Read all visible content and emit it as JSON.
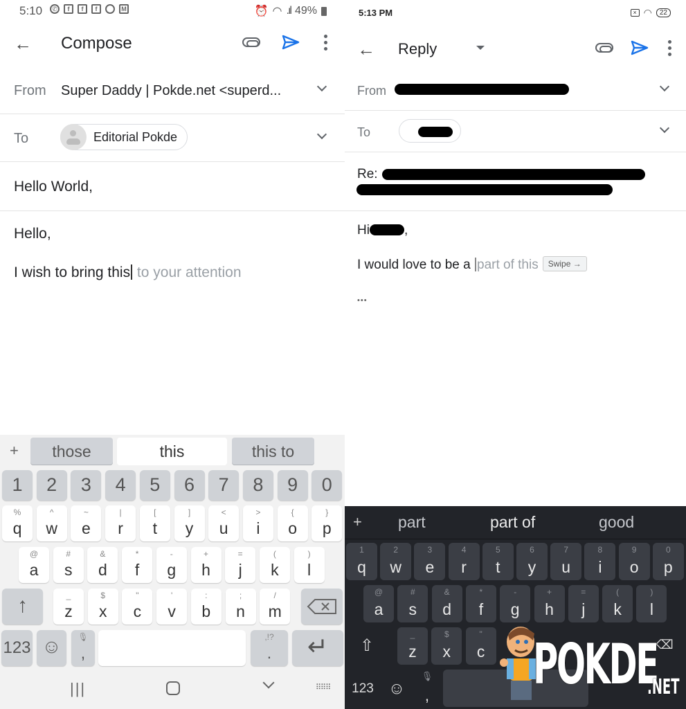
{
  "left": {
    "status": {
      "time": "5:10",
      "notifications": [
        "whatsapp-icon",
        "facebook-icon",
        "facebook-icon",
        "facebook-icon",
        "chrome-icon",
        "gmail-icon"
      ],
      "battery": "49%"
    },
    "appbar": {
      "title": "Compose"
    },
    "from": {
      "label": "From",
      "value": "Super Daddy | Pokde.net <superd..."
    },
    "to": {
      "label": "To",
      "recipient": "Editorial Pokde"
    },
    "subject": "Hello World,",
    "body": {
      "line1": "Hello,",
      "typed": "I wish to bring this",
      "suggestion": " to your attention"
    },
    "keyboard": {
      "suggestions": [
        "those",
        "this",
        "this to"
      ],
      "numbers": [
        "1",
        "2",
        "3",
        "4",
        "5",
        "6",
        "7",
        "8",
        "9",
        "0"
      ],
      "row1": [
        [
          "q",
          "%"
        ],
        [
          "w",
          "^"
        ],
        [
          "e",
          "~"
        ],
        [
          "r",
          "|"
        ],
        [
          "t",
          "["
        ],
        [
          "y",
          "]"
        ],
        [
          "u",
          "<"
        ],
        [
          "i",
          ">"
        ],
        [
          "o",
          "{"
        ],
        [
          "p",
          "}"
        ]
      ],
      "row2": [
        [
          "a",
          "@"
        ],
        [
          "s",
          "#"
        ],
        [
          "d",
          "&"
        ],
        [
          "f",
          "*"
        ],
        [
          "g",
          "-"
        ],
        [
          "h",
          "+"
        ],
        [
          "j",
          "="
        ],
        [
          "k",
          "("
        ],
        [
          "l",
          ")"
        ]
      ],
      "row3": [
        [
          "z",
          "_"
        ],
        [
          "x",
          "$"
        ],
        [
          "c",
          "\""
        ],
        [
          "v",
          "'"
        ],
        [
          "b",
          ":"
        ],
        [
          "n",
          ";"
        ],
        [
          "m",
          "/"
        ]
      ],
      "mode_label": "123",
      "comma": ",",
      "period": ".",
      "period_sub": ",!?"
    }
  },
  "right": {
    "status": {
      "time": "5:13 PM",
      "battery": "22"
    },
    "appbar": {
      "title": "Reply"
    },
    "from": {
      "label": "From"
    },
    "to": {
      "label": "To"
    },
    "subject_prefix": "Re:",
    "body": {
      "greeting": "Hi",
      "greeting_suffix": ",",
      "typed": "I would love to be a ",
      "suggestion": "part of this",
      "swipe_chip": "Swipe →",
      "ellipsis": "•••"
    },
    "keyboard": {
      "suggestions": [
        "part",
        "part of",
        "good"
      ],
      "row1": [
        [
          "q",
          "1"
        ],
        [
          "w",
          "2"
        ],
        [
          "e",
          "3"
        ],
        [
          "r",
          "4"
        ],
        [
          "t",
          "5"
        ],
        [
          "y",
          "6"
        ],
        [
          "u",
          "7"
        ],
        [
          "i",
          "8"
        ],
        [
          "o",
          "9"
        ],
        [
          "p",
          "0"
        ]
      ],
      "row2": [
        [
          "a",
          "@"
        ],
        [
          "s",
          "#"
        ],
        [
          "d",
          "&"
        ],
        [
          "f",
          "*"
        ],
        [
          "g",
          "-"
        ],
        [
          "h",
          "+"
        ],
        [
          "j",
          "="
        ],
        [
          "k",
          "("
        ],
        [
          "l",
          ")"
        ]
      ],
      "row3": [
        [
          "z",
          "_"
        ],
        [
          "x",
          "$"
        ],
        [
          "c",
          "\""
        ]
      ],
      "mode_label": "123",
      "comma": ","
    }
  },
  "watermark": {
    "brand": "POKDE",
    "tld": ".NET"
  },
  "colors": {
    "send_blue": "#1a73e8",
    "dark_keyboard": "#222429"
  }
}
